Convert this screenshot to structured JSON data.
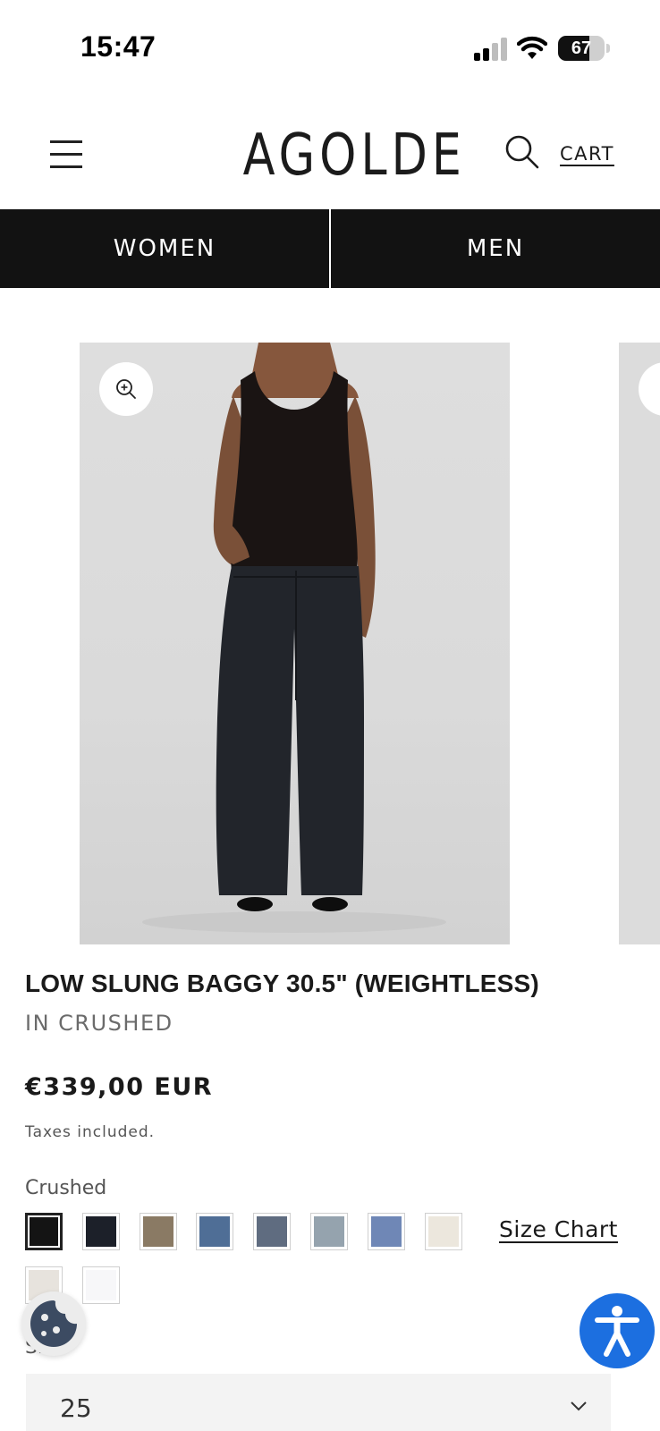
{
  "status_bar": {
    "time": "15:47",
    "battery": "67",
    "battery_level": 0.67
  },
  "header": {
    "logo": "AGOLDE",
    "cart_label": "CART"
  },
  "nav": {
    "tabs": [
      "WOMEN",
      "MEN"
    ]
  },
  "product": {
    "title": "LOW SLUNG BAGGY 30.5\" (WEIGHTLESS)",
    "colorway": "IN CRUSHED",
    "price": "€339,00 EUR",
    "tax_note": "Taxes included.",
    "color_label": "Crushed",
    "swatches": [
      {
        "name": "Crushed",
        "color": "#141414",
        "selected": true
      },
      {
        "name": "Navy",
        "color": "#1c2029"
      },
      {
        "name": "Khaki",
        "color": "#8a7a64"
      },
      {
        "name": "Mid Blue",
        "color": "#4f6e96"
      },
      {
        "name": "Grey Blue",
        "color": "#5f6c80"
      },
      {
        "name": "Light Grey Blue",
        "color": "#95a3ae"
      },
      {
        "name": "Light Blue",
        "color": "#6f87b6"
      },
      {
        "name": "Ecru",
        "color": "#ece7dd"
      },
      {
        "name": "Stone",
        "color": "#e7e3dd"
      },
      {
        "name": "White",
        "color": "#f7f7f9"
      }
    ],
    "size_chart_label": "Size Chart",
    "size_label": "Size",
    "size_value": "25"
  },
  "colors": {
    "nav_bg": "#121212",
    "accessibility_blue": "#1c6fe0",
    "cookie_icon": "#3c4b62"
  },
  "icons": [
    "menu-icon",
    "search-icon",
    "zoom-in-icon",
    "cookie-icon",
    "accessibility-icon",
    "chevron-down-icon",
    "signal-icon",
    "wifi-icon",
    "battery-icon"
  ]
}
